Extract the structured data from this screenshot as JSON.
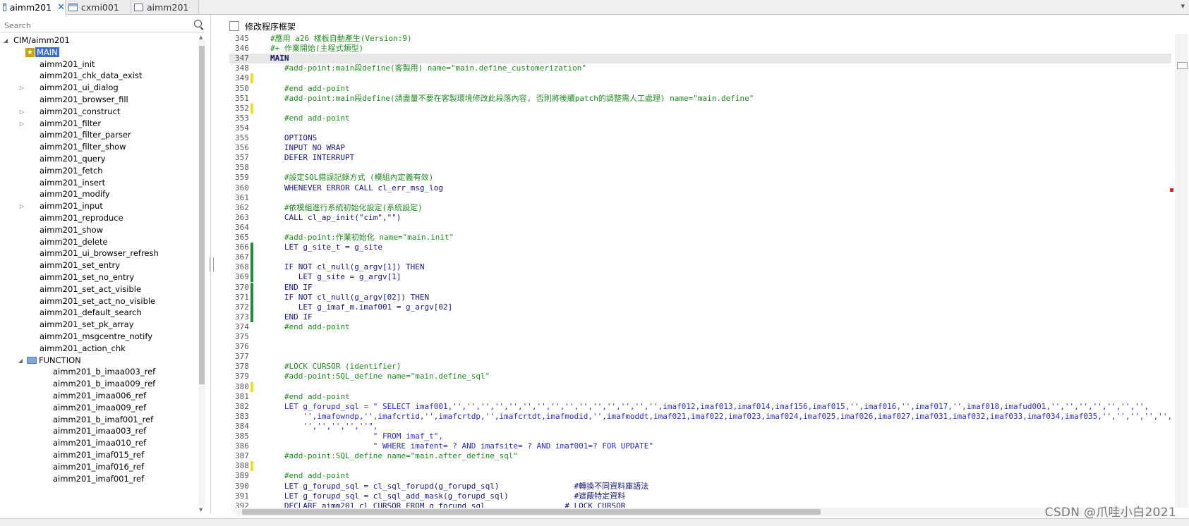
{
  "tabs": [
    {
      "label": "aimm201",
      "active": true,
      "closable": true
    },
    {
      "label": "cxmi001",
      "active": false,
      "closable": false
    },
    {
      "label": "aimm201",
      "active": false,
      "closable": false
    }
  ],
  "search": {
    "placeholder": "Search"
  },
  "tree": {
    "root": "CIM/aimm201",
    "main_label": "MAIN",
    "items": [
      "aimm201_init",
      "aimm201_chk_data_exist",
      "aimm201_ui_dialog",
      "aimm201_browser_fill",
      "aimm201_construct",
      "aimm201_filter",
      "aimm201_filter_parser",
      "aimm201_filter_show",
      "aimm201_query",
      "aimm201_fetch",
      "aimm201_insert",
      "aimm201_modify",
      "aimm201_input",
      "aimm201_reproduce",
      "aimm201_show",
      "aimm201_delete",
      "aimm201_ui_browser_refresh",
      "aimm201_set_entry",
      "aimm201_set_no_entry",
      "aimm201_set_act_visible",
      "aimm201_set_act_no_visible",
      "aimm201_default_search",
      "aimm201_set_pk_array",
      "aimm201_msgcentre_notify",
      "aimm201_action_chk"
    ],
    "expandable_items": [
      "aimm201_ui_dialog",
      "aimm201_construct",
      "aimm201_filter",
      "aimm201_input"
    ],
    "function_label": "FUNCTION",
    "function_items": [
      "aimm201_b_imaa003_ref",
      "aimm201_b_imaa009_ref",
      "aimm201_imaa006_ref",
      "aimm201_imaa009_ref",
      "aimm201_b_imaf001_ref",
      "aimm201_imaa003_ref",
      "aimm201_imaa010_ref",
      "aimm201_imaf015_ref",
      "aimm201_imaf016_ref",
      "aimm201_imaf001_ref"
    ]
  },
  "editor": {
    "checkbox_label": "修改程序框架",
    "lines": [
      {
        "n": "345",
        "code": "#應用 a26 樣板自動產生(Version:9)",
        "style": "green"
      },
      {
        "n": "346",
        "code": "#+ 作業開始(主程式類型)",
        "style": "green"
      },
      {
        "n": "347",
        "code": "MAIN",
        "style": "bold",
        "highlight": true
      },
      {
        "n": "348",
        "code": "   #add-point:main段define(客製用) name=\"main.define_customerization\"",
        "style": "green"
      },
      {
        "n": "349",
        "code": "",
        "marker": "yellow"
      },
      {
        "n": "350",
        "code": "   #end add-point",
        "style": "green"
      },
      {
        "n": "351",
        "code": "   #add-point:main段define(請盡量不要在客製環境修改此段落內容, 否則將後續patch的調整需人工處理) name=\"main.define\"",
        "style": "green"
      },
      {
        "n": "352",
        "code": "",
        "marker": "yellow"
      },
      {
        "n": "353",
        "code": "   #end add-point",
        "style": "green"
      },
      {
        "n": "354",
        "code": ""
      },
      {
        "n": "355",
        "code": "   OPTIONS",
        "style": "blue"
      },
      {
        "n": "356",
        "code": "   INPUT NO WRAP",
        "style": "blue"
      },
      {
        "n": "357",
        "code": "   DEFER INTERRUPT",
        "style": "blue"
      },
      {
        "n": "358",
        "code": ""
      },
      {
        "n": "359",
        "code": "   #設定SQL錯誤記錄方式 (模組內定義有效)",
        "style": "green"
      },
      {
        "n": "360",
        "code": "   WHENEVER ERROR CALL cl_err_msg_log",
        "style": "blue"
      },
      {
        "n": "361",
        "code": ""
      },
      {
        "n": "362",
        "code": "   #依模組進行系統初始化設定(系統設定)",
        "style": "green"
      },
      {
        "n": "363",
        "code": "   CALL cl_ap_init(\"cim\",\"\")",
        "style": "blue"
      },
      {
        "n": "364",
        "code": ""
      },
      {
        "n": "365",
        "code": "   #add-point:作業初始化 name=\"main.init\"",
        "style": "green"
      },
      {
        "n": "366",
        "code": "   LET g_site_t = g_site",
        "style": "blue",
        "marker": "green"
      },
      {
        "n": "367",
        "code": "",
        "marker": "green"
      },
      {
        "n": "368",
        "code": "   IF NOT cl_null(g_argv[1]) THEN",
        "style": "blue",
        "marker": "green"
      },
      {
        "n": "369",
        "code": "      LET g_site = g_argv[1]",
        "style": "blue",
        "marker": "green"
      },
      {
        "n": "370",
        "code": "   END IF",
        "style": "blue",
        "marker": "green"
      },
      {
        "n": "371",
        "code": "   IF NOT cl_null(g_argv[02]) THEN",
        "style": "blue",
        "marker": "green"
      },
      {
        "n": "372",
        "code": "      LET g_imaf_m.imaf001 = g_argv[02]",
        "style": "blue",
        "marker": "green"
      },
      {
        "n": "373",
        "code": "   END IF",
        "style": "blue",
        "marker": "green"
      },
      {
        "n": "374",
        "code": "   #end add-point",
        "style": "green"
      },
      {
        "n": "375",
        "code": ""
      },
      {
        "n": "376",
        "code": ""
      },
      {
        "n": "377",
        "code": ""
      },
      {
        "n": "378",
        "code": "   #LOCK CURSOR (identifier)",
        "style": "green"
      },
      {
        "n": "379",
        "code": "   #add-point:SQL_define name=\"main.define_sql\"",
        "style": "green"
      },
      {
        "n": "380",
        "code": "",
        "marker": "yellow"
      },
      {
        "n": "381",
        "code": "   #end add-point",
        "style": "green"
      },
      {
        "n": "382",
        "code": "   LET g_forupd_sql = \" SELECT imaf001,'','','','','','','','','','','','','','','',imaf012,imaf013,imaf014,imaf156,imaf015,'',imaf016,'',imaf017,'',imaf018,imafud001,'','','','','','','',",
        "style": "str"
      },
      {
        "n": "383",
        "code": "       '',imafowndp,'',imafcrtid,'',imafcrtdp,'',imafcrtdt,imafmodid,'',imafmoddt,imaf021,imaf022,imaf023,imaf024,imaf025,imaf026,imaf027,imaf031,imaf032,imaf033,imaf034,imaf035,'','','','','',",
        "style": "str"
      },
      {
        "n": "384",
        "code": "       '','','','',''\",",
        "style": "str"
      },
      {
        "n": "385",
        "code": "                      \" FROM imaf_t\",",
        "style": "str"
      },
      {
        "n": "386",
        "code": "                      \" WHERE imafent= ? AND imafsite= ? AND imaf001=? FOR UPDATE\"",
        "style": "str"
      },
      {
        "n": "387",
        "code": "   #add-point:SQL_define name=\"main.after_define_sql\"",
        "style": "green"
      },
      {
        "n": "388",
        "code": "",
        "marker": "yellow"
      },
      {
        "n": "389",
        "code": "   #end add-point",
        "style": "green"
      },
      {
        "n": "390",
        "code": "   LET g_forupd_sql = cl_sql_forupd(g_forupd_sql)                #轉換不同資料庫語法",
        "style": "blue"
      },
      {
        "n": "391",
        "code": "   LET g_forupd_sql = cl_sql_add_mask(g_forupd_sql)              #遮蔽特定資料",
        "style": "blue"
      },
      {
        "n": "392",
        "code": "   DECLARE aimm201_cl CURSOR FROM g_forupd_sql                 # LOCK CURSOR",
        "style": "blue"
      }
    ]
  },
  "watermark": "CSDN @爪哇小白2021",
  "colors": {
    "selection": "#3d6fc6",
    "comment": "#218a21",
    "keyword": "#18187a",
    "marker_green": "#1d8f3a",
    "marker_yellow": "#f0e020"
  }
}
